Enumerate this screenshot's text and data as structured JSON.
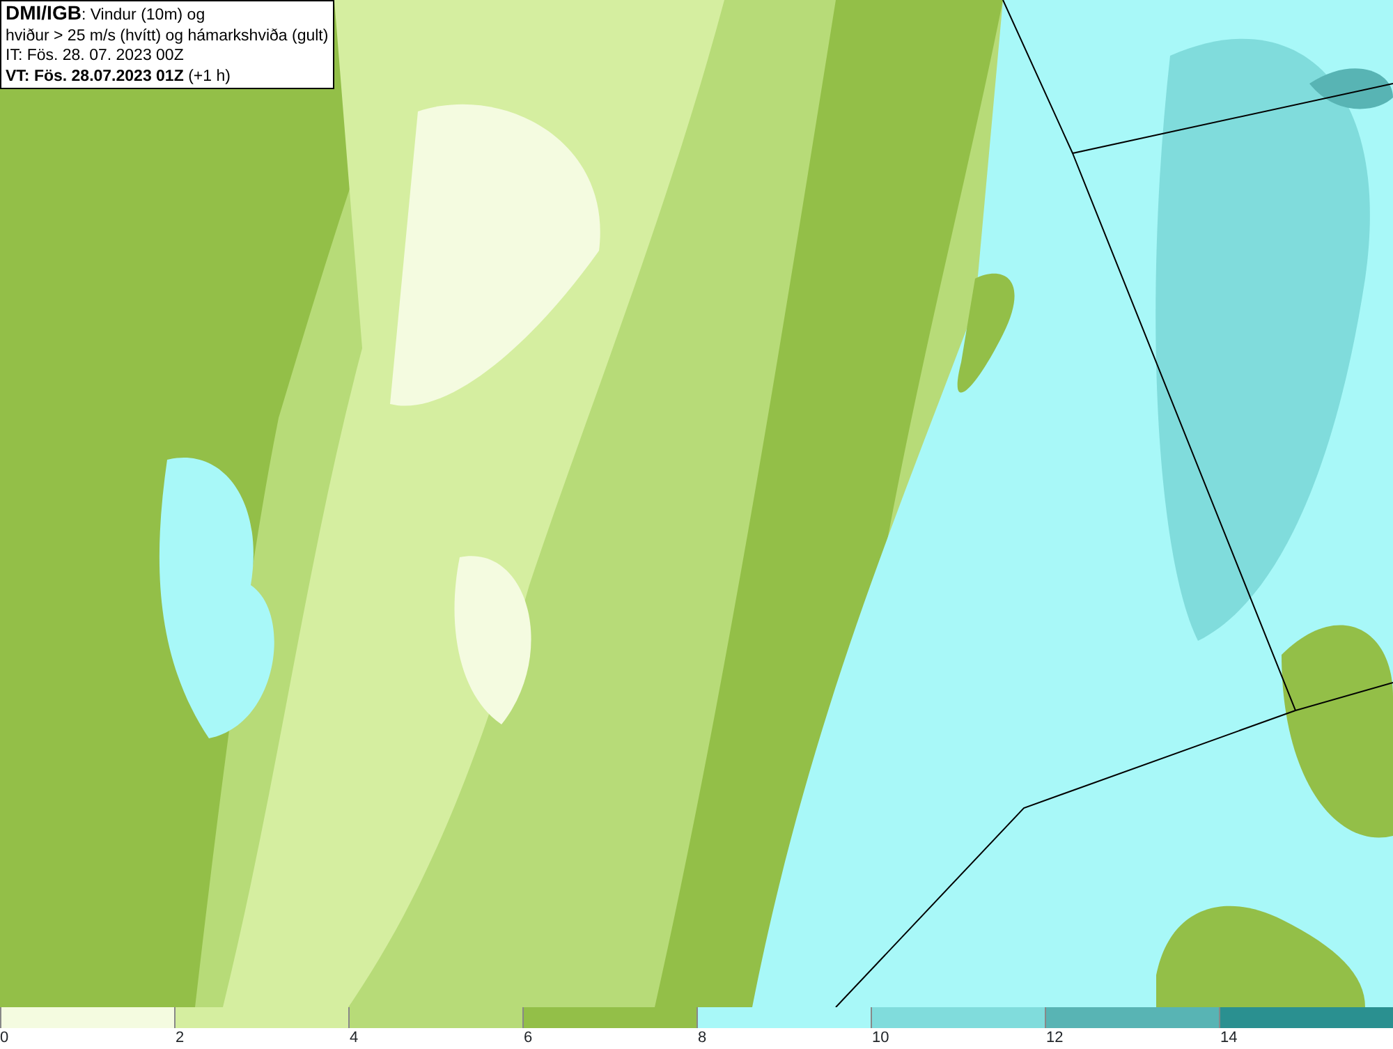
{
  "header": {
    "source": "DMI/IGB",
    "title": ": Vindur (10m) og",
    "subtitle": "hviður > 25 m/s (hvítt) og hámarkshviða (gult)",
    "init_time": "IT: Fös. 28. 07. 2023 00Z",
    "valid_time": "VT: Fös. 28.07.2023 01Z",
    "lead": "(+1 h)"
  },
  "legend": [
    {
      "color": "#f4fbe0",
      "tick": "0"
    },
    {
      "color": "#d5eea0",
      "tick": "2"
    },
    {
      "color": "#b7db78",
      "tick": "4"
    },
    {
      "color": "#93bf48",
      "tick": "6"
    },
    {
      "color": "#a8f8f8",
      "tick": "8"
    },
    {
      "color": "#80dcdc",
      "tick": "10"
    },
    {
      "color": "#58b4b4",
      "tick": "12"
    },
    {
      "color": "#2a9090",
      "tick": "14"
    }
  ]
}
